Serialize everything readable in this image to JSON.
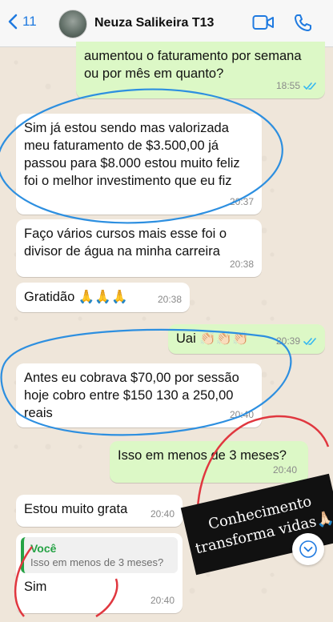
{
  "header": {
    "back_count": "11",
    "contact_name": "Neuza Salikeira T13"
  },
  "messages": [
    {
      "text": "aumentou o faturamento por semana ou por mês em quanto?",
      "time": "18:55"
    },
    {
      "text": "Sim já estou sendo mas valorizada meu faturamento de $3.500,00 já passou para $8.000 estou muito feliz foi o melhor investimento que eu fiz",
      "time": "20:37"
    },
    {
      "text": "Faço vários cursos mais esse foi o divisor de água na minha carreira",
      "time": "20:38"
    },
    {
      "text": "Gratidão 🙏🙏🙏",
      "time": "20:38"
    },
    {
      "text": "Uai 👏🏻👏🏻👏🏻",
      "time": "20:39"
    },
    {
      "text": "Antes eu cobrava $70,00 por sessão hoje cobro entre $150 130 a 250,00 reais",
      "time": "20:40"
    },
    {
      "text": "Isso em menos de 3 meses?",
      "time": "20:40"
    },
    {
      "text": "Estou muito grata",
      "time": "20:40"
    },
    {
      "quote_author": "Você",
      "quote_text": "Isso em menos de 3 meses?",
      "text": "Sim",
      "time": "20:40"
    }
  ],
  "caption": {
    "line1": "Conhecimento",
    "line2": "transforma vidas🙏🏻"
  },
  "colors": {
    "accent": "#1f7ae0",
    "outgoing_bubble": "#dcf8c6",
    "incoming_bubble": "#ffffff",
    "read_ticks": "#34b7f1",
    "annotation_blue": "#2d8fe0",
    "annotation_red": "#e0373f"
  },
  "icons": [
    "chevron-left-icon",
    "video-camera-icon",
    "phone-icon",
    "double-check-icon",
    "chevron-down-icon"
  ]
}
